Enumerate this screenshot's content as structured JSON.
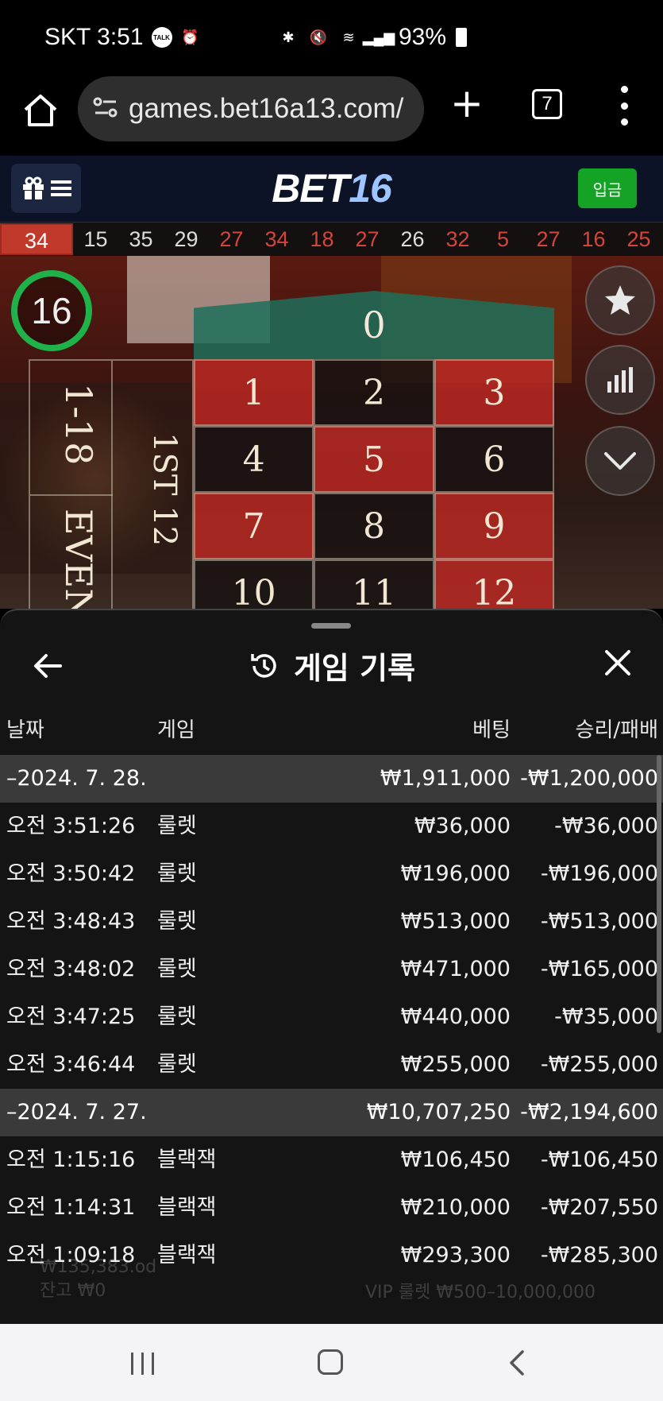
{
  "status_bar": {
    "carrier_time": "SKT 3:51",
    "talk_badge": "TALK",
    "battery_pct": "93%"
  },
  "browser": {
    "url": "games.bet16a13.com/",
    "tab_count": "7"
  },
  "site_header": {
    "logo_bet": "BET",
    "logo_num": "16",
    "deposit_label": "입금"
  },
  "history_strip": [
    {
      "n": "34",
      "color": "red"
    },
    {
      "n": "15",
      "color": "black"
    },
    {
      "n": "35",
      "color": "black"
    },
    {
      "n": "29",
      "color": "black"
    },
    {
      "n": "27",
      "color": "red"
    },
    {
      "n": "34",
      "color": "red"
    },
    {
      "n": "18",
      "color": "red"
    },
    {
      "n": "27",
      "color": "red"
    },
    {
      "n": "26",
      "color": "black"
    },
    {
      "n": "32",
      "color": "red"
    },
    {
      "n": "5",
      "color": "red"
    },
    {
      "n": "27",
      "color": "red"
    },
    {
      "n": "16",
      "color": "red"
    },
    {
      "n": "25",
      "color": "red"
    }
  ],
  "game": {
    "timer": "16",
    "zero": "0",
    "grid": [
      [
        {
          "n": "1",
          "c": "red"
        },
        {
          "n": "2",
          "c": "black"
        },
        {
          "n": "3",
          "c": "red"
        }
      ],
      [
        {
          "n": "4",
          "c": "black"
        },
        {
          "n": "5",
          "c": "red"
        },
        {
          "n": "6",
          "c": "black"
        }
      ],
      [
        {
          "n": "7",
          "c": "red"
        },
        {
          "n": "8",
          "c": "black"
        },
        {
          "n": "9",
          "c": "red"
        }
      ],
      [
        {
          "n": "10",
          "c": "black"
        },
        {
          "n": "11",
          "c": "black"
        },
        {
          "n": "12",
          "c": "red"
        }
      ]
    ],
    "outside_1_18": "1-18",
    "outside_even": "EVEN",
    "outside_1st12": "1ST 12"
  },
  "sheet": {
    "title": "게임 기록",
    "columns": {
      "date": "날짜",
      "game": "게임",
      "bet": "베팅",
      "result": "승리/패배"
    },
    "groups": [
      {
        "date": "–2024. 7. 28.",
        "bet_total": "₩1,911,000",
        "result_total": "-₩1,200,000",
        "rows": [
          {
            "time": "오전 3:51:26",
            "game": "룰렛",
            "bet": "₩36,000",
            "result": "-₩36,000"
          },
          {
            "time": "오전 3:50:42",
            "game": "룰렛",
            "bet": "₩196,000",
            "result": "-₩196,000"
          },
          {
            "time": "오전 3:48:43",
            "game": "룰렛",
            "bet": "₩513,000",
            "result": "-₩513,000"
          },
          {
            "time": "오전 3:48:02",
            "game": "룰렛",
            "bet": "₩471,000",
            "result": "-₩165,000"
          },
          {
            "time": "오전 3:47:25",
            "game": "룰렛",
            "bet": "₩440,000",
            "result": "-₩35,000"
          },
          {
            "time": "오전 3:46:44",
            "game": "룰렛",
            "bet": "₩255,000",
            "result": "-₩255,000"
          }
        ]
      },
      {
        "date": "–2024. 7. 27.",
        "bet_total": "₩10,707,250",
        "result_total": "-₩2,194,600",
        "rows": [
          {
            "time": "오전 1:15:16",
            "game": "블랙잭",
            "bet": "₩106,450",
            "result": "-₩106,450"
          },
          {
            "time": "오전 1:14:31",
            "game": "블랙잭",
            "bet": "₩210,000",
            "result": "-₩207,550"
          },
          {
            "time": "오전 1:09:18",
            "game": "블랙잭",
            "bet": "₩293,300",
            "result": "-₩285,300"
          }
        ]
      }
    ],
    "faded_balance": "₩135,383.od",
    "faded_balance2": "잔고 ₩0",
    "faded_limits": "VIP 룰렛 ₩500–10,000,000"
  },
  "colors": {
    "accent_green": "#14a325",
    "roulette_red": "#be2823",
    "timer_green": "#1fb24a"
  }
}
